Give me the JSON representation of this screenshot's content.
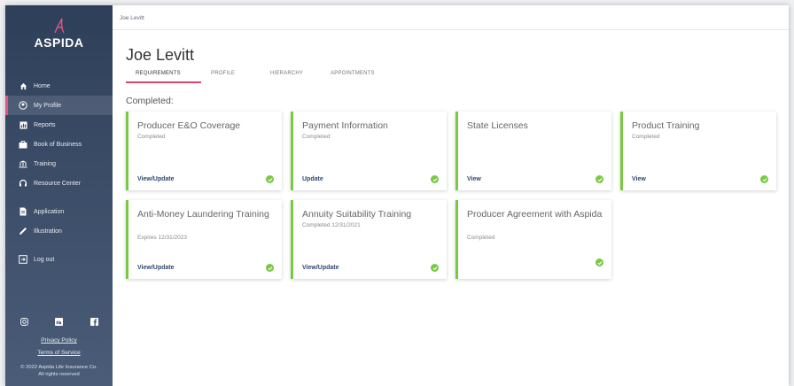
{
  "app": {
    "brand": "ASPIDA",
    "breadcrumb": "Joe Levitt",
    "accent_color": "#d9456b",
    "complete_color": "#7ac943"
  },
  "sidebar": {
    "items": [
      {
        "label": "Home",
        "icon": "home-icon"
      },
      {
        "label": "My Profile",
        "icon": "user-circle-icon"
      },
      {
        "label": "Reports",
        "icon": "reports-icon"
      },
      {
        "label": "Book of Business",
        "icon": "briefcase-icon"
      },
      {
        "label": "Training",
        "icon": "institution-icon"
      },
      {
        "label": "Resource Center",
        "icon": "headset-icon"
      },
      {
        "label": "Application",
        "icon": "document-icon"
      },
      {
        "label": "Illustration",
        "icon": "pencil-icon"
      },
      {
        "label": "Log out",
        "icon": "logout-icon"
      }
    ],
    "active": "My Profile",
    "social": [
      "instagram-icon",
      "linkedin-icon",
      "facebook-icon"
    ],
    "privacy": "Privacy Policy",
    "terms": "Terms of Service",
    "copyright_line1": "© 2022 Aspida Life Insurance Co.",
    "copyright_line2": "All rights reserved"
  },
  "page": {
    "title": "Joe Levitt",
    "tabs": [
      "REQUIREMENTS",
      "PROFILE",
      "HIERARCHY",
      "APPOINTMENTS"
    ],
    "active_tab": "REQUIREMENTS",
    "section": "Completed:"
  },
  "cards": [
    {
      "title": "Producer E&O Coverage",
      "status": "Completed",
      "action": "View/Update"
    },
    {
      "title": "Payment Information",
      "status": "Completed",
      "action": "Update"
    },
    {
      "title": "State Licenses",
      "status": "",
      "action": "View"
    },
    {
      "title": "Product Training",
      "status": "Completed",
      "action": "View"
    },
    {
      "title": "Anti-Money Laundering Training",
      "status": "Expires 12/31/2023",
      "action": "View/Update"
    },
    {
      "title": "Annuity Suitability Training",
      "status": "Completed 12/31/2021",
      "action": "View/Update"
    },
    {
      "title": "Producer Agreement with Aspida",
      "status": "Completed",
      "action": ""
    }
  ]
}
